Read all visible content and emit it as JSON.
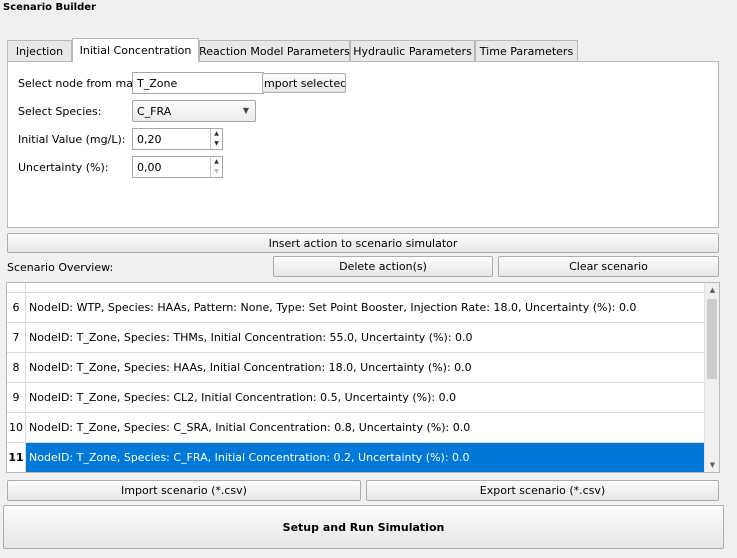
{
  "window": {
    "title": "Scenario Builder"
  },
  "tabs": [
    {
      "label": "Injection"
    },
    {
      "label": "Initial Concentration"
    },
    {
      "label": "Reaction Model Parameters"
    },
    {
      "label": "Hydraulic Parameters"
    },
    {
      "label": "Time Parameters"
    }
  ],
  "active_tab": "Initial Concentration",
  "form": {
    "node_label": "Select node from map:",
    "node_value": "T_Zone",
    "import_selected_label": "Import selected",
    "species_label": "Select Species:",
    "species_value": "C_FRA",
    "initial_value_label": "Initial Value (mg/L):",
    "initial_value": "0,20",
    "uncertainty_label": "Uncertainty (%):",
    "uncertainty_value": "0,00"
  },
  "insert_action_label": "Insert action to scenario simulator",
  "overview": {
    "label": "Scenario Overview:",
    "delete_label": "Delete action(s)",
    "clear_label": "Clear scenario",
    "rows": [
      {
        "num": "6",
        "text": "NodeID: WTP, Species: HAAs, Pattern: None, Type: Set Point Booster, Injection Rate: 18.0, Uncertainty (%): 0.0"
      },
      {
        "num": "7",
        "text": "NodeID: T_Zone, Species: THMs, Initial Concentration: 55.0, Uncertainty (%): 0.0"
      },
      {
        "num": "8",
        "text": "NodeID: T_Zone, Species: HAAs, Initial Concentration: 18.0, Uncertainty (%): 0.0"
      },
      {
        "num": "9",
        "text": "NodeID: T_Zone, Species: CL2, Initial Concentration: 0.5, Uncertainty (%): 0.0"
      },
      {
        "num": "10",
        "text": "NodeID: T_Zone, Species: C_SRA, Initial Concentration: 0.8, Uncertainty (%): 0.0"
      },
      {
        "num": "11",
        "text": "NodeID: T_Zone, Species: C_FRA, Initial Concentration: 0.2, Uncertainty (%): 0.0"
      }
    ],
    "selected_row": "11"
  },
  "import_scenario_label": "Import scenario (*.csv)",
  "export_scenario_label": "Export scenario (*.csv)",
  "run_label": "Setup and Run Simulation",
  "colors": {
    "selection": "#0078d7"
  }
}
